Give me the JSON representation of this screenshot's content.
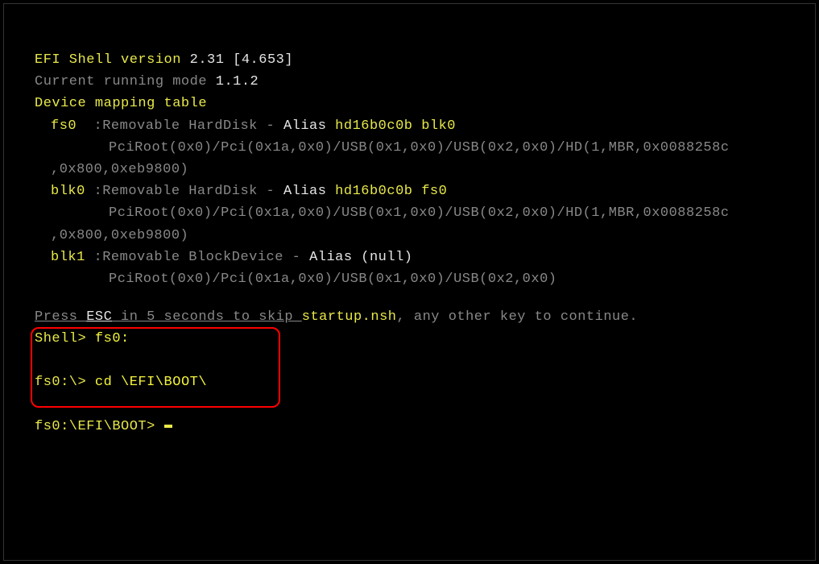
{
  "header": {
    "shell_label": "EFI Shell version ",
    "shell_version": "2.31 [4.653]",
    "mode_label": "Current running mode ",
    "mode_version": "1.1.2",
    "table_header": "Device mapping table"
  },
  "devices": {
    "fs0": {
      "name": "fs0  ",
      "desc": ":Removable HardDisk - ",
      "alias_label": "Alias ",
      "alias_values": "hd16b0c0b blk0",
      "path": "PciRoot(0x0)/Pci(0x1a,0x0)/USB(0x1,0x0)/USB(0x2,0x0)/HD(1,MBR,0x0088258c",
      "path2": ",0x800,0xeb9800)"
    },
    "blk0": {
      "name": "blk0 ",
      "desc": ":Removable HardDisk - ",
      "alias_label": "Alias ",
      "alias_values": "hd16b0c0b fs0",
      "path": "PciRoot(0x0)/Pci(0x1a,0x0)/USB(0x1,0x0)/USB(0x2,0x0)/HD(1,MBR,0x0088258c",
      "path2": ",0x800,0xeb9800)"
    },
    "blk1": {
      "name": "blk1 ",
      "desc": ":Removable BlockDevice - ",
      "alias_label": "Alias ",
      "alias_values": "(null)",
      "path": "PciRoot(0x0)/Pci(0x1a,0x0)/USB(0x1,0x0)/USB(0x2,0x0)"
    }
  },
  "escape_msg": {
    "p1": "Press ",
    "esc": "ESC",
    "p2": " in 5 seconds to skip ",
    "filename": "startup.nsh",
    "p3": ", any other key to continue."
  },
  "commands": {
    "shell_prompt": "Shell> ",
    "cmd1": "fs0:",
    "fs0_prompt": "fs0:\\> ",
    "cmd2": "cd \\EFI\\BOOT\\",
    "boot_prompt": "fs0:\\EFI\\BOOT> "
  }
}
